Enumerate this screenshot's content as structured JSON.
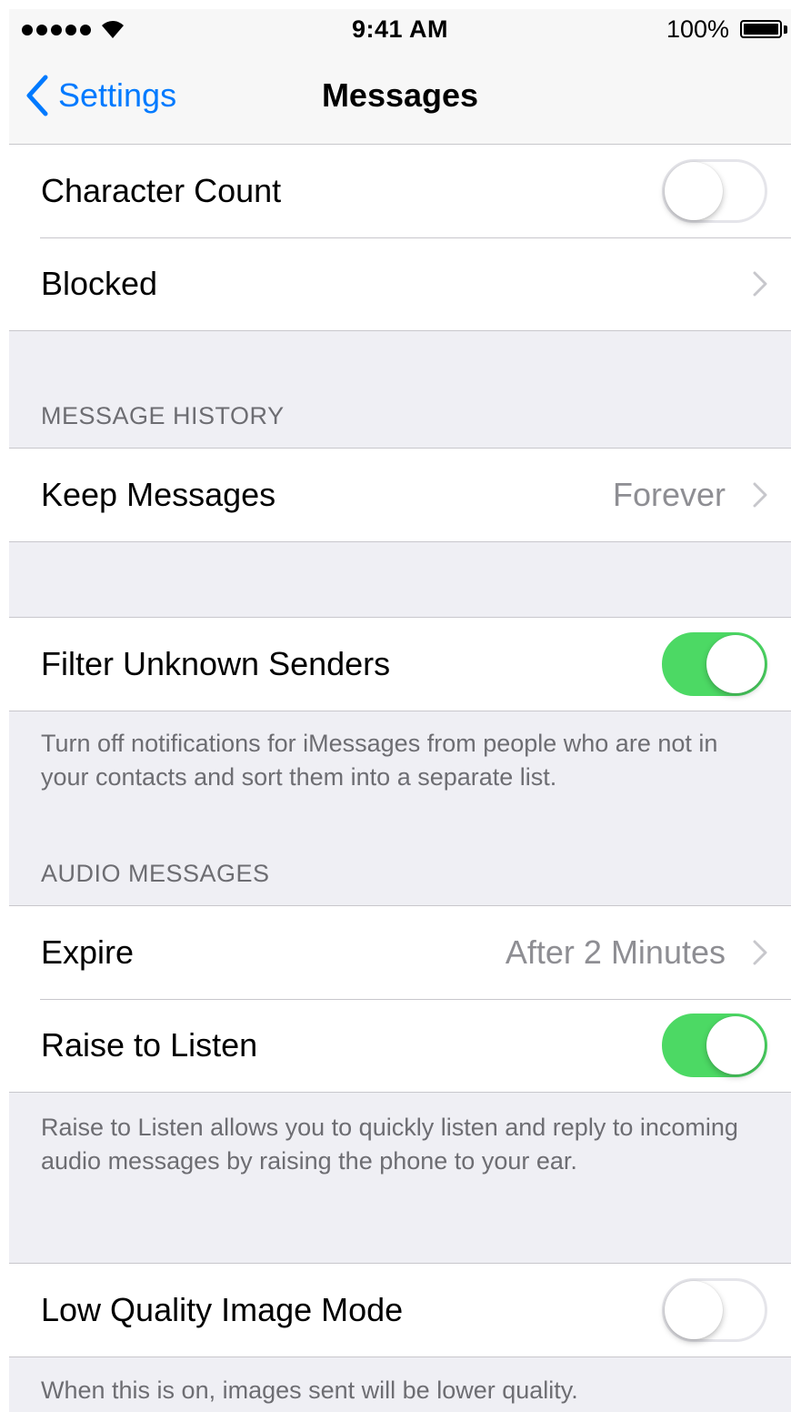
{
  "status_bar": {
    "time": "9:41 AM",
    "battery_percent": "100%"
  },
  "nav": {
    "back_label": "Settings",
    "title": "Messages"
  },
  "rows": {
    "character_count": {
      "label": "Character Count",
      "on": false
    },
    "blocked": {
      "label": "Blocked"
    },
    "keep_messages": {
      "label": "Keep Messages",
      "value": "Forever"
    },
    "filter_unknown": {
      "label": "Filter Unknown Senders",
      "on": true
    },
    "expire": {
      "label": "Expire",
      "value": "After 2 Minutes"
    },
    "raise_to_listen": {
      "label": "Raise to Listen",
      "on": true
    },
    "low_quality": {
      "label": "Low Quality Image Mode",
      "on": false
    }
  },
  "sections": {
    "message_history": "MESSAGE HISTORY",
    "audio_messages": "AUDIO MESSAGES"
  },
  "notes": {
    "filter_unknown": "Turn off notifications for iMessages from people who are not in your contacts and sort them into a separate list.",
    "raise_to_listen": "Raise to Listen allows you to quickly listen and reply to incoming audio messages by raising the phone to your ear.",
    "low_quality": "When this is on, images sent will be lower quality."
  },
  "colors": {
    "accent": "#007aff",
    "switch_on": "#4cd964",
    "background": "#efeff4"
  }
}
